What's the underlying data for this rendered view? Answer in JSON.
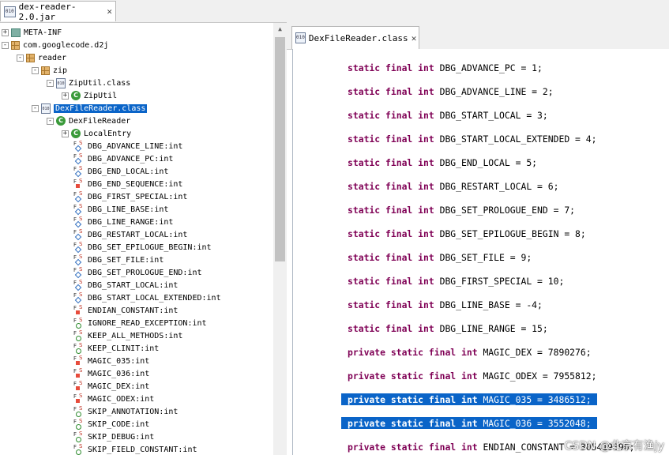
{
  "left_tab": {
    "icon": "jar-file-icon",
    "label": "dex-reader-2.0.jar"
  },
  "right_tab": {
    "icon": "class-file-icon",
    "label": "DexFileReader.class"
  },
  "tree": [
    {
      "text": "META-INF",
      "icon": "folder",
      "exp": "+"
    },
    {
      "text": "com.googlecode.d2j",
      "icon": "package",
      "exp": "-"
    },
    {
      "text": "reader",
      "icon": "package",
      "exp": "-"
    },
    {
      "text": "zip",
      "icon": "package",
      "exp": "-"
    },
    {
      "text": "ZipUtil.class",
      "icon": "file",
      "exp": "-"
    },
    {
      "text": "ZipUtil",
      "icon": "class",
      "exp": "+"
    },
    {
      "text": "DexFileReader.class",
      "icon": "file",
      "exp": "-",
      "selected": true
    },
    {
      "text": "DexFileReader",
      "icon": "class",
      "exp": "-"
    },
    {
      "text": "LocalEntry",
      "icon": "class",
      "exp": "+"
    },
    {
      "text": "DBG_ADVANCE_LINE",
      "type": "int",
      "icon": "field-protected"
    },
    {
      "text": "DBG_ADVANCE_PC",
      "type": "int",
      "icon": "field-protected"
    },
    {
      "text": "DBG_END_LOCAL",
      "type": "int",
      "icon": "field-protected"
    },
    {
      "text": "DBG_END_SEQUENCE",
      "type": "int",
      "icon": "field-private"
    },
    {
      "text": "DBG_FIRST_SPECIAL",
      "type": "int",
      "icon": "field-protected"
    },
    {
      "text": "DBG_LINE_BASE",
      "type": "int",
      "icon": "field-protected"
    },
    {
      "text": "DBG_LINE_RANGE",
      "type": "int",
      "icon": "field-protected"
    },
    {
      "text": "DBG_RESTART_LOCAL",
      "type": "int",
      "icon": "field-protected"
    },
    {
      "text": "DBG_SET_EPILOGUE_BEGIN",
      "type": "int",
      "icon": "field-protected"
    },
    {
      "text": "DBG_SET_FILE",
      "type": "int",
      "icon": "field-protected"
    },
    {
      "text": "DBG_SET_PROLOGUE_END",
      "type": "int",
      "icon": "field-protected"
    },
    {
      "text": "DBG_START_LOCAL",
      "type": "int",
      "icon": "field-protected"
    },
    {
      "text": "DBG_START_LOCAL_EXTENDED",
      "type": "int",
      "icon": "field-protected"
    },
    {
      "text": "ENDIAN_CONSTANT",
      "type": "int",
      "icon": "field-private"
    },
    {
      "text": "IGNORE_READ_EXCEPTION",
      "type": "int",
      "icon": "field-public"
    },
    {
      "text": "KEEP_ALL_METHODS",
      "type": "int",
      "icon": "field-public"
    },
    {
      "text": "KEEP_CLINIT",
      "type": "int",
      "icon": "field-public"
    },
    {
      "text": "MAGIC_035",
      "type": "int",
      "icon": "field-private"
    },
    {
      "text": "MAGIC_036",
      "type": "int",
      "icon": "field-private"
    },
    {
      "text": "MAGIC_DEX",
      "type": "int",
      "icon": "field-private"
    },
    {
      "text": "MAGIC_ODEX",
      "type": "int",
      "icon": "field-private"
    },
    {
      "text": "SKIP_ANNOTATION",
      "type": "int",
      "icon": "field-public"
    },
    {
      "text": "SKIP_CODE",
      "type": "int",
      "icon": "field-public"
    },
    {
      "text": "SKIP_DEBUG",
      "type": "int",
      "icon": "field-public"
    },
    {
      "text": "SKIP_FIELD_CONSTANT",
      "type": "int",
      "icon": "field-public"
    }
  ],
  "code_lines": [
    {
      "mods": "static final int",
      "rest": "DBG_ADVANCE_PC = 1;"
    },
    {
      "mods": "static final int",
      "rest": "DBG_ADVANCE_LINE = 2;"
    },
    {
      "mods": "static final int",
      "rest": "DBG_START_LOCAL = 3;"
    },
    {
      "mods": "static final int",
      "rest": "DBG_START_LOCAL_EXTENDED = 4;"
    },
    {
      "mods": "static final int",
      "rest": "DBG_END_LOCAL = 5;"
    },
    {
      "mods": "static final int",
      "rest": "DBG_RESTART_LOCAL = 6;"
    },
    {
      "mods": "static final int",
      "rest": "DBG_SET_PROLOGUE_END = 7;"
    },
    {
      "mods": "static final int",
      "rest": "DBG_SET_EPILOGUE_BEGIN = 8;"
    },
    {
      "mods": "static final int",
      "rest": "DBG_SET_FILE = 9;"
    },
    {
      "mods": "static final int",
      "rest": "DBG_FIRST_SPECIAL = 10;"
    },
    {
      "mods": "static final int",
      "rest": "DBG_LINE_BASE = -4;"
    },
    {
      "mods": "static final int",
      "rest": "DBG_LINE_RANGE = 15;"
    },
    {
      "mods": "private static final int",
      "rest": "MAGIC_DEX = 7890276;"
    },
    {
      "mods": "private static final int",
      "rest": "MAGIC_ODEX = 7955812;"
    },
    {
      "mods": "private static final int",
      "rest": "MAGIC_035 = 3486512;",
      "highlight": true
    },
    {
      "mods": "private static final int",
      "rest": "MAGIC_036 = 3552048;",
      "highlight": true
    },
    {
      "mods": "private static final int",
      "rest": "ENDIAN_CONSTANT = 305419896;"
    }
  ],
  "watermark": "CSDN @北京有渔jy",
  "colors": {
    "keyword": "#7f0055",
    "selection": "#0a64c8"
  }
}
